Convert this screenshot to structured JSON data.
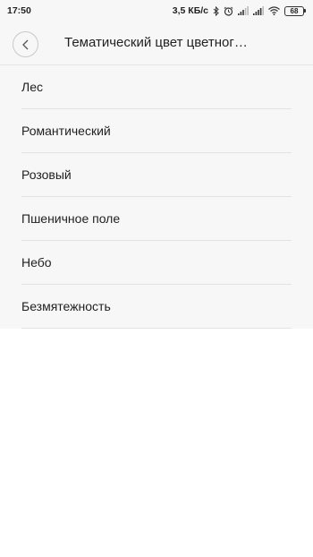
{
  "status_bar": {
    "time": "17:50",
    "speed": "3,5 КБ/с",
    "battery": "68",
    "icons": [
      "bluetooth-icon",
      "alarm-icon",
      "signal-icon",
      "signal-icon",
      "wifi-icon",
      "battery-icon"
    ]
  },
  "header": {
    "title": "Тематический цвет цветног…",
    "back_icon": "chevron-left-icon"
  },
  "list": {
    "items": [
      {
        "label": "Лес"
      },
      {
        "label": "Романтический"
      },
      {
        "label": "Розовый"
      },
      {
        "label": "Пшеничное поле"
      },
      {
        "label": "Небо"
      },
      {
        "label": "Безмятежность"
      }
    ]
  }
}
